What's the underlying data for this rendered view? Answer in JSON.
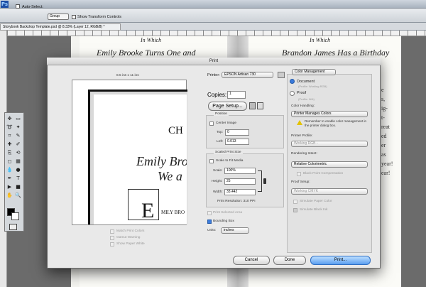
{
  "appbar": {
    "logo": "Ps"
  },
  "options": {
    "auto_select": "Auto-Select:",
    "group": "Group",
    "show_transform": "Show Transform Controls"
  },
  "doc_tab": "Storybook Backdrop Template.psd @ 8.33% (Layer 12, RGB/8) *",
  "book": {
    "left_heading": "In Which",
    "left_title": "Emily Brooke Turns One and",
    "right_heading": "In Which",
    "right_title": "Brandon James Has a Birthday",
    "right_lines": [
      "e",
      "s,",
      "ig-",
      "t-",
      "reat",
      "ed",
      "er",
      "as",
      "year!",
      "ear!"
    ]
  },
  "dialog": {
    "title": "Print",
    "paper_size": "8.5 ins x 11 ins",
    "preview_ch": "CH",
    "preview_line1": "Emily Broo",
    "preview_line2": "We a",
    "preview_E": "E",
    "preview_mily": "MILY BRO",
    "match_print": "Match Print Colors",
    "gamut_warning": "Gamut Warning",
    "show_paper_white": "Show Paper White",
    "printer_label": "Printer:",
    "printer_value": "EPSON Artisan 730",
    "copies_label": "Copies:",
    "copies_value": "1",
    "page_setup": "Page Setup...",
    "position_label": "Position",
    "center_image": "Center Image",
    "top_label": "Top:",
    "top_value": "0",
    "left_label": "Left:",
    "left_value": "0.013",
    "scaled_label": "Scaled Print Size",
    "scale_to_fit": "Scale to Fit Media",
    "scale_label": "Scale:",
    "scale_value": "100%",
    "height_label": "Height:",
    "height_value": "25",
    "width_label": "Width:",
    "width_value": "33.442",
    "print_resolution": "Print Resolution: 310 PPI",
    "print_selected_area": "Print Selected Area",
    "bounding_box": "Bounding Box",
    "units_label": "Units:",
    "units_value": "inches",
    "color_mgmt": "Color Management",
    "document": "Document",
    "document_sub": "(Profile: Working RGB)",
    "proof": "Proof",
    "proof_sub": "(Profile: N/A)",
    "color_handling_label": "Color Handling:",
    "color_handling_value": "Printer Manages Colors",
    "reminder": "Remember to enable color management in the printer dialog box.",
    "printer_profile_label": "Printer Profile:",
    "printer_profile_value": "Working RGB -",
    "rendering_label": "Rendering Intent:",
    "rendering_value": "Relative Colorimetric",
    "black_point": "Black Point Compensation",
    "proof_setup_label": "Proof Setup:",
    "proof_setup_value": "Working CMYK",
    "sim_paper": "Simulate Paper Color",
    "sim_black": "Simulate Black Ink",
    "cancel": "Cancel",
    "done": "Done",
    "print": "Print..."
  }
}
